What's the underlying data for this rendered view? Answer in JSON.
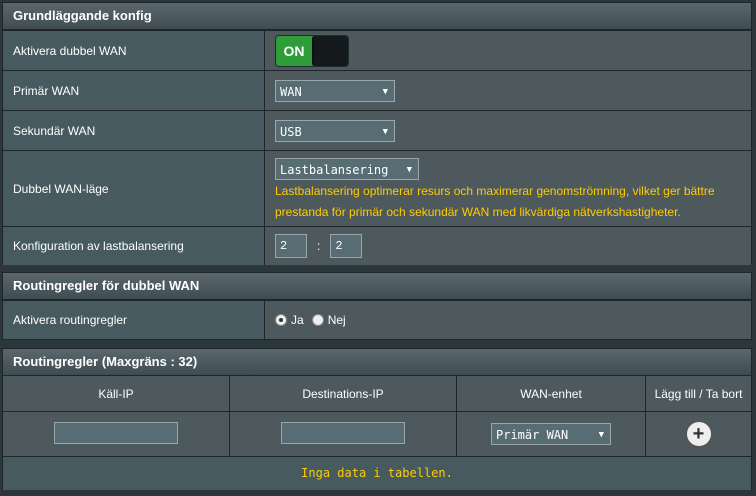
{
  "basic": {
    "title": "Grundläggande konfig",
    "enable_dual_wan_label": "Aktivera dubbel WAN",
    "toggle_text": "ON",
    "primary_wan_label": "Primär WAN",
    "primary_wan_value": "WAN",
    "secondary_wan_label": "Sekundär WAN",
    "secondary_wan_value": "USB",
    "mode_label": "Dubbel WAN-läge",
    "mode_value": "Lastbalansering",
    "mode_hint": "Lastbalansering optimerar resurs och maximerar genomströmning, vilket ger bättre prestanda för primär och sekundär WAN med likvärdiga nätverkshastigheter.",
    "lb_label": "Konfiguration av lastbalansering",
    "lb_value1": "2",
    "lb_sep": ":",
    "lb_value2": "2"
  },
  "routing": {
    "title": "Routingregler för dubbel WAN",
    "enable_label": "Aktivera routingregler",
    "option_yes": "Ja",
    "option_no": "Nej",
    "selected": "Ja"
  },
  "rules": {
    "title": "Routingregler (Maxgräns : 32)",
    "col_source": "Käll-IP",
    "col_dest": "Destinations-IP",
    "col_wan": "WAN-enhet",
    "col_action": "Lägg till / Ta bort",
    "wan_select_value": "Primär WAN",
    "no_data": "Inga data i tabellen."
  },
  "icons": {
    "add": "plus-circle-icon",
    "dropdown": "chevron-down-icon"
  },
  "colors": {
    "accent_on": "#2f9c3a",
    "hint": "#ffcc00",
    "background": "#2b373b"
  }
}
